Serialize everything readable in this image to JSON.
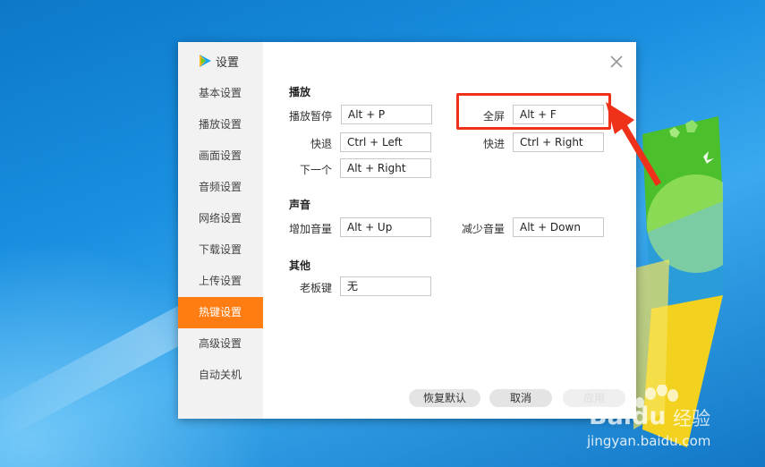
{
  "dialog": {
    "title": "设置",
    "close_icon": "close-icon"
  },
  "sidebar": {
    "items": [
      {
        "label": "基本设置",
        "active": false
      },
      {
        "label": "播放设置",
        "active": false
      },
      {
        "label": "画面设置",
        "active": false
      },
      {
        "label": "音频设置",
        "active": false
      },
      {
        "label": "网络设置",
        "active": false
      },
      {
        "label": "下载设置",
        "active": false
      },
      {
        "label": "上传设置",
        "active": false
      },
      {
        "label": "热键设置",
        "active": true
      },
      {
        "label": "高级设置",
        "active": false
      },
      {
        "label": "自动关机",
        "active": false
      }
    ]
  },
  "sections": {
    "playback": {
      "title": "播放",
      "play_pause": {
        "label": "播放暂停",
        "value": "Alt + P"
      },
      "fullscreen": {
        "label": "全屏",
        "value": "Alt + F"
      },
      "rewind": {
        "label": "快退",
        "value": "Ctrl + Left"
      },
      "forward": {
        "label": "快进",
        "value": "Ctrl + Right"
      },
      "next": {
        "label": "下一个",
        "value": "Alt + Right"
      }
    },
    "sound": {
      "title": "声音",
      "volume_up": {
        "label": "增加音量",
        "value": "Alt + Up"
      },
      "volume_down": {
        "label": "减少音量",
        "value": "Alt + Down"
      }
    },
    "other": {
      "title": "其他",
      "boss_key": {
        "label": "老板键",
        "value": "无"
      }
    }
  },
  "footer": {
    "restore_default": "恢复默认",
    "cancel": "取消",
    "apply": "应用"
  },
  "watermark": {
    "brand": "Baidu",
    "brand_cn": "经验",
    "url": "jingyan.baidu.com"
  },
  "colors": {
    "accent": "#ff7d13",
    "highlight": "#f0311a"
  }
}
